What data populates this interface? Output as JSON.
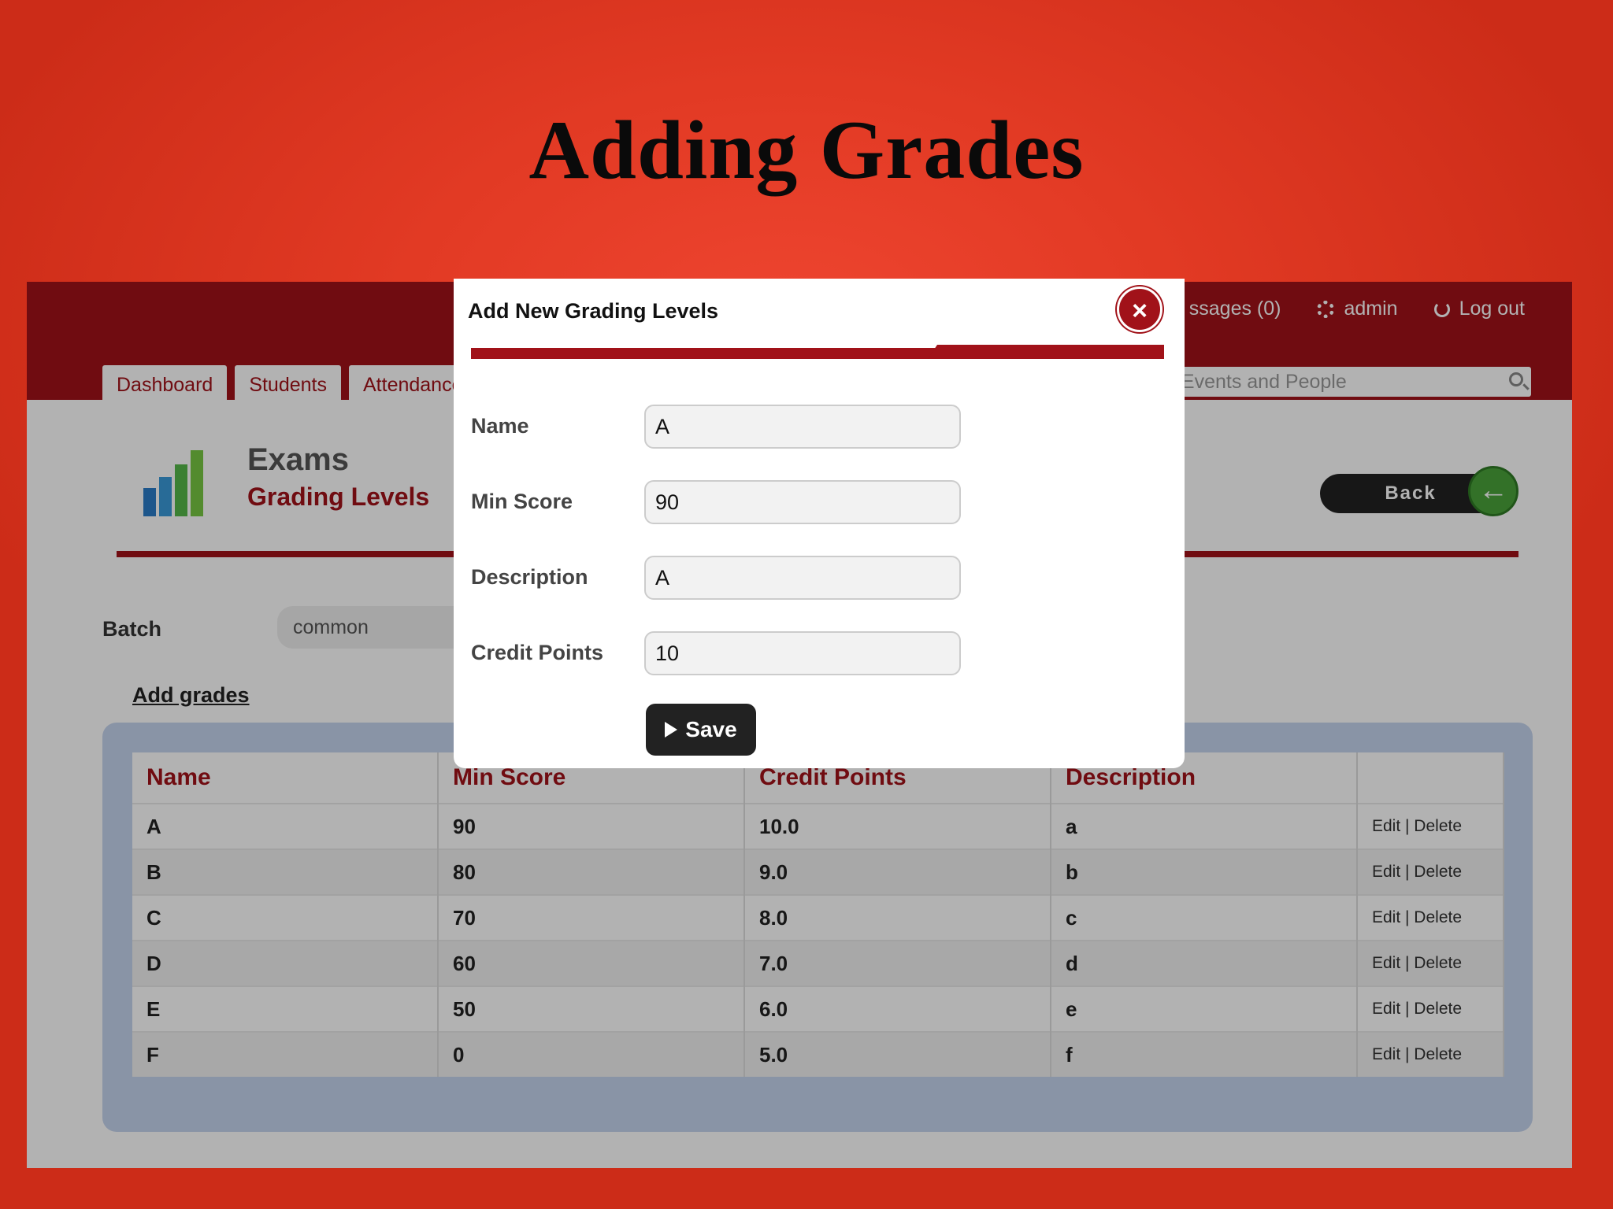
{
  "slide": {
    "title": "Adding Grades"
  },
  "header": {
    "messages": "ssages (0)",
    "user": "admin",
    "logout": "Log out"
  },
  "tabs": [
    "Dashboard",
    "Students",
    "Attendance"
  ],
  "search": {
    "placeholder": ", Events and People"
  },
  "page": {
    "title": "Exams",
    "subtitle": "Grading Levels",
    "back_label": "Back"
  },
  "batch": {
    "label": "Batch",
    "value": "common"
  },
  "add_grades_link": "Add grades",
  "table": {
    "headers": [
      "Name",
      "Min Score",
      "Credit Points",
      "Description",
      ""
    ],
    "rows": [
      [
        "A",
        "90",
        "10.0",
        "a",
        "Edit | Delete"
      ],
      [
        "B",
        "80",
        "9.0",
        "b",
        "Edit | Delete"
      ],
      [
        "C",
        "70",
        "8.0",
        "c",
        "Edit | Delete"
      ],
      [
        "D",
        "60",
        "7.0",
        "d",
        "Edit | Delete"
      ],
      [
        "E",
        "50",
        "6.0",
        "e",
        "Edit | Delete"
      ],
      [
        "F",
        "0",
        "5.0",
        "f",
        "Edit | Delete"
      ]
    ]
  },
  "modal": {
    "title": "Add New Grading Levels",
    "close_symbol": "×",
    "fields": [
      {
        "label": "Name",
        "value": "A"
      },
      {
        "label": "Min Score",
        "value": "90"
      },
      {
        "label": "Description",
        "value": "A"
      },
      {
        "label": "Credit Points",
        "value": "10"
      }
    ],
    "save_label": "Save"
  },
  "colors": {
    "accent": "#a11219",
    "background": "#e23a24"
  }
}
